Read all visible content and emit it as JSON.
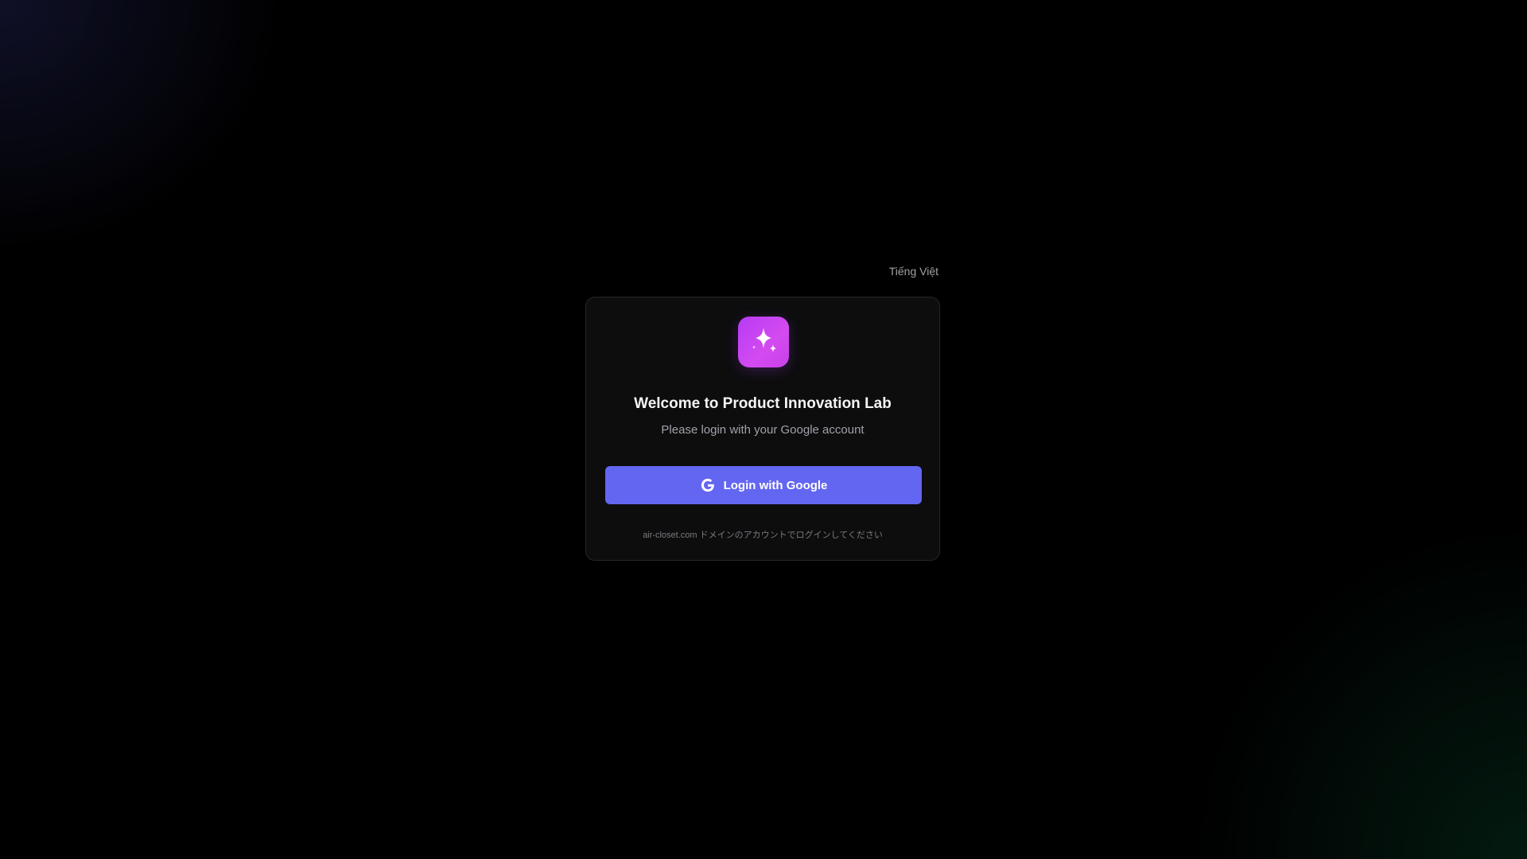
{
  "language_switch": {
    "label": "Tiếng Việt"
  },
  "login_card": {
    "logo_icon": "sparkles-icon",
    "title": "Welcome to Product Innovation Lab",
    "subtitle": "Please login with your Google account",
    "login_button": {
      "label": "Login with Google",
      "icon": "google-g-icon"
    },
    "footnote": "air-closet.com ドメインのアカウントでログインしてください"
  },
  "colors": {
    "background": "#000000",
    "card_background": "#0d0d0e",
    "card_border": "#26262a",
    "button_primary": "#6366f1",
    "logo_gradient_start": "#b63bf5",
    "logo_gradient_end": "#d34bf0",
    "title_text": "#f5f5f5",
    "muted_text": "#a1a1aa"
  }
}
